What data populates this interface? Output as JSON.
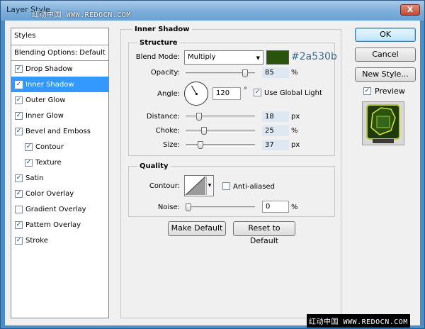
{
  "window": {
    "title": "Layer Style",
    "close_label": "X",
    "watermark_top": "红动中国 WWW.REDOCN.COM",
    "watermark_bottom": "红动中国 WWW.REDOCN.COM"
  },
  "styles": {
    "header": "Styles",
    "blending": "Blending Options: Default",
    "items": [
      {
        "label": "Drop Shadow",
        "checked": true
      },
      {
        "label": "Inner Shadow",
        "checked": true
      },
      {
        "label": "Outer Glow",
        "checked": true
      },
      {
        "label": "Inner Glow",
        "checked": true
      },
      {
        "label": "Bevel and Emboss",
        "checked": true
      },
      {
        "label": "Contour",
        "checked": true
      },
      {
        "label": "Texture",
        "checked": true
      },
      {
        "label": "Satin",
        "checked": true
      },
      {
        "label": "Color Overlay",
        "checked": true
      },
      {
        "label": "Gradient Overlay",
        "checked": false
      },
      {
        "label": "Pattern Overlay",
        "checked": true
      },
      {
        "label": "Stroke",
        "checked": true
      }
    ]
  },
  "inner_shadow": {
    "title": "Inner Shadow",
    "structure": {
      "title": "Structure",
      "blend_mode_label": "Blend Mode:",
      "blend_mode": "Multiply",
      "color_hex": "#2a530b",
      "color": "#2a530b",
      "opacity_label": "Opacity:",
      "opacity": "85",
      "opacity_unit": "%",
      "angle_label": "Angle:",
      "angle": "120",
      "angle_unit": "°",
      "global_light_label": "Use Global Light",
      "global_light": true,
      "distance_label": "Distance:",
      "distance": "18",
      "distance_unit": "px",
      "choke_label": "Choke:",
      "choke": "25",
      "choke_unit": "%",
      "size_label": "Size:",
      "size": "37",
      "size_unit": "px"
    },
    "quality": {
      "title": "Quality",
      "contour_label": "Contour:",
      "anti_aliased_label": "Anti-aliased",
      "anti_aliased": false,
      "noise_label": "Noise:",
      "noise": "0",
      "noise_unit": "%"
    },
    "make_default": "Make Default",
    "reset_default": "Reset to Default"
  },
  "buttons": {
    "ok": "OK",
    "cancel": "Cancel",
    "new_style": "New Style...",
    "preview_label": "Preview",
    "preview": true
  }
}
